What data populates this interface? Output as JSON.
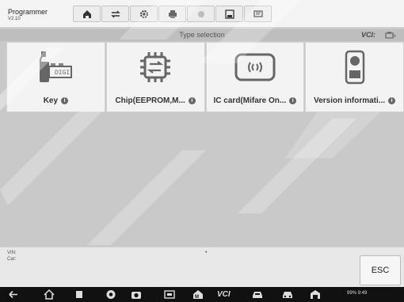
{
  "header": {
    "title": "Programmer",
    "version": "V2.10"
  },
  "toolbar": {
    "buttons": [
      {
        "icon": "home-icon"
      },
      {
        "icon": "vehicle-swap-icon"
      },
      {
        "icon": "settings-gear-icon"
      },
      {
        "icon": "print-icon"
      },
      {
        "icon": "help-icon"
      },
      {
        "icon": "save-icon"
      },
      {
        "icon": "message-icon"
      }
    ]
  },
  "subbar": {
    "title": "Type selection",
    "vci_label": "VCI:"
  },
  "cards": [
    {
      "label": "Key",
      "icon": "key-icon"
    },
    {
      "label": "Chip(EEPROM,M...",
      "icon": "chip-icon"
    },
    {
      "label": "IC card(Mifare On...",
      "icon": "ic-card-icon"
    },
    {
      "label": "Version informati...",
      "icon": "version-info-icon"
    }
  ],
  "info_panel": {
    "vin_label": "VIN:",
    "car_label": "Car:",
    "esc_label": "ESC"
  },
  "navbar": {
    "vci_text": "VCI",
    "status_text": "99%  9:49"
  },
  "colors": {
    "header_bg": "#f4f4f4",
    "content_bg": "#c9c9c9",
    "card_bg": "#f3f3f3",
    "navbar_bg": "#111111"
  }
}
